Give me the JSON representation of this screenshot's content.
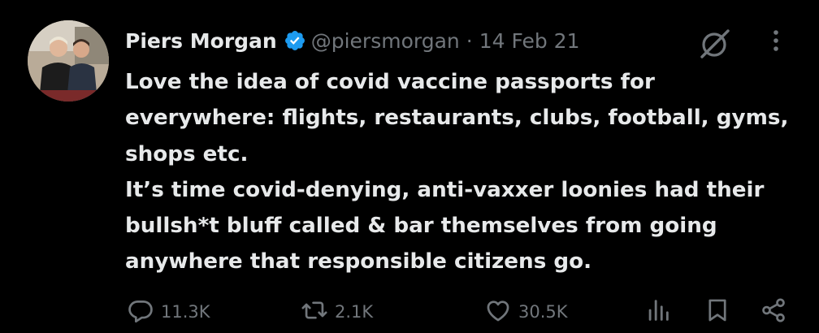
{
  "tweet": {
    "author_name": "Piers Morgan",
    "handle": "@piersmorgan",
    "separator": "·",
    "date": "14 Feb 21",
    "text": "Love the idea of covid vaccine passports for everywhere: flights, restaurants, clubs, football, gyms, shops etc.\nIt’s time covid-denying, anti-vaxxer loonies had their bullsh*t bluff called & bar themselves from going anywhere that responsible citizens go."
  },
  "actions": {
    "replies": "11.3K",
    "retweets": "2.1K",
    "likes": "30.5K"
  },
  "colors": {
    "background": "#000000",
    "text": "#e7e9ea",
    "secondary": "#71767b",
    "verified": "#1d9bf0"
  },
  "icons": {
    "verified": "verified-badge-icon",
    "grok": "grok-icon",
    "more": "more-dots-icon",
    "reply": "reply-bubble-icon",
    "retweet": "retweet-icon",
    "like": "heart-icon",
    "views": "views-bars-icon",
    "bookmark": "bookmark-icon",
    "share": "share-icon"
  }
}
